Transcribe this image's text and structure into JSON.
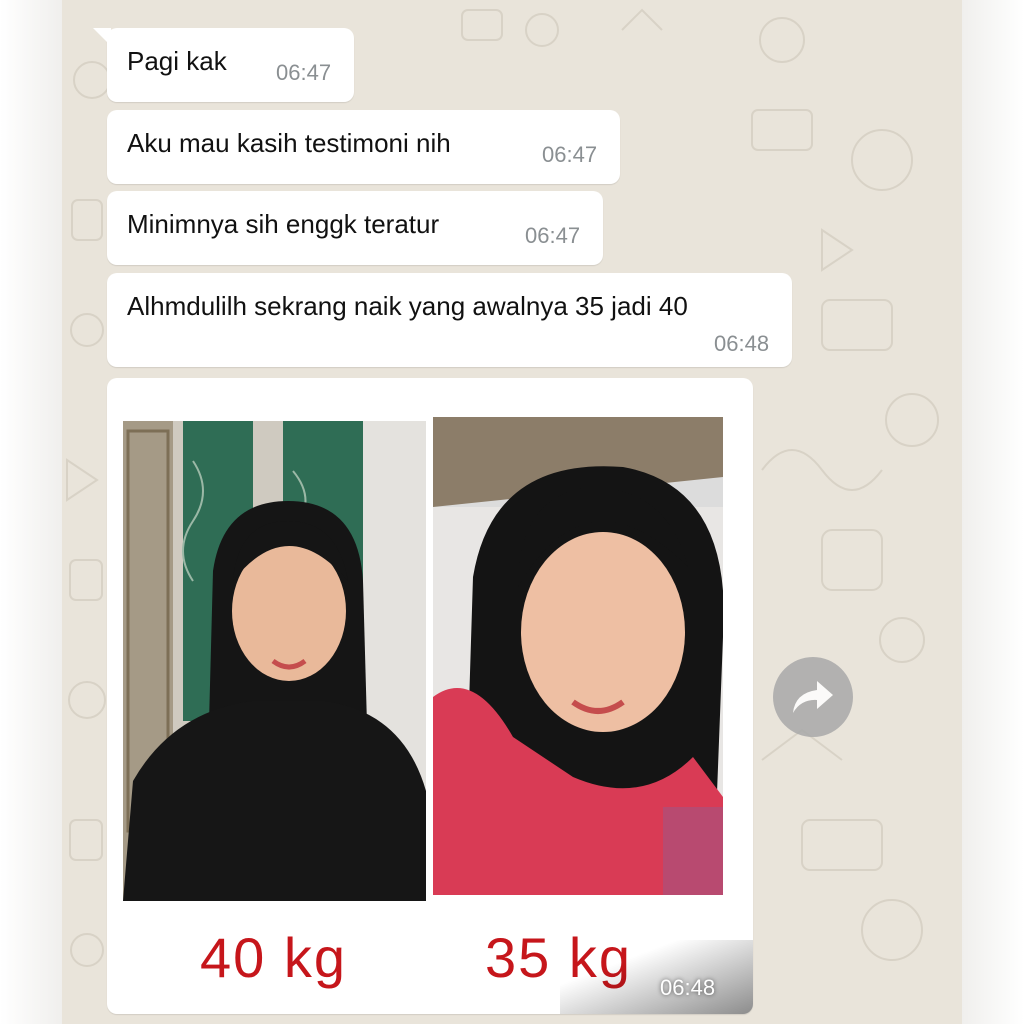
{
  "messages": [
    {
      "text": "Pagi kak",
      "time": "06:47"
    },
    {
      "text": "Aku mau kasih testimoni nih",
      "time": "06:47"
    },
    {
      "text": "Minimnya sih enggk teratur",
      "time": "06:47"
    },
    {
      "text": "Alhmdulilh sekrang naik yang awalnya 35 jadi 40",
      "time": "06:48"
    }
  ],
  "image_message": {
    "label_left": "40  kg",
    "label_right": "35  kg",
    "time": "06:48"
  },
  "icons": {
    "forward": "forward-share-icon"
  },
  "colors": {
    "chat_background": "#e9e4da",
    "bubble": "#ffffff",
    "weight_label": "#c6161b",
    "timestamp": "#8a8f92"
  }
}
